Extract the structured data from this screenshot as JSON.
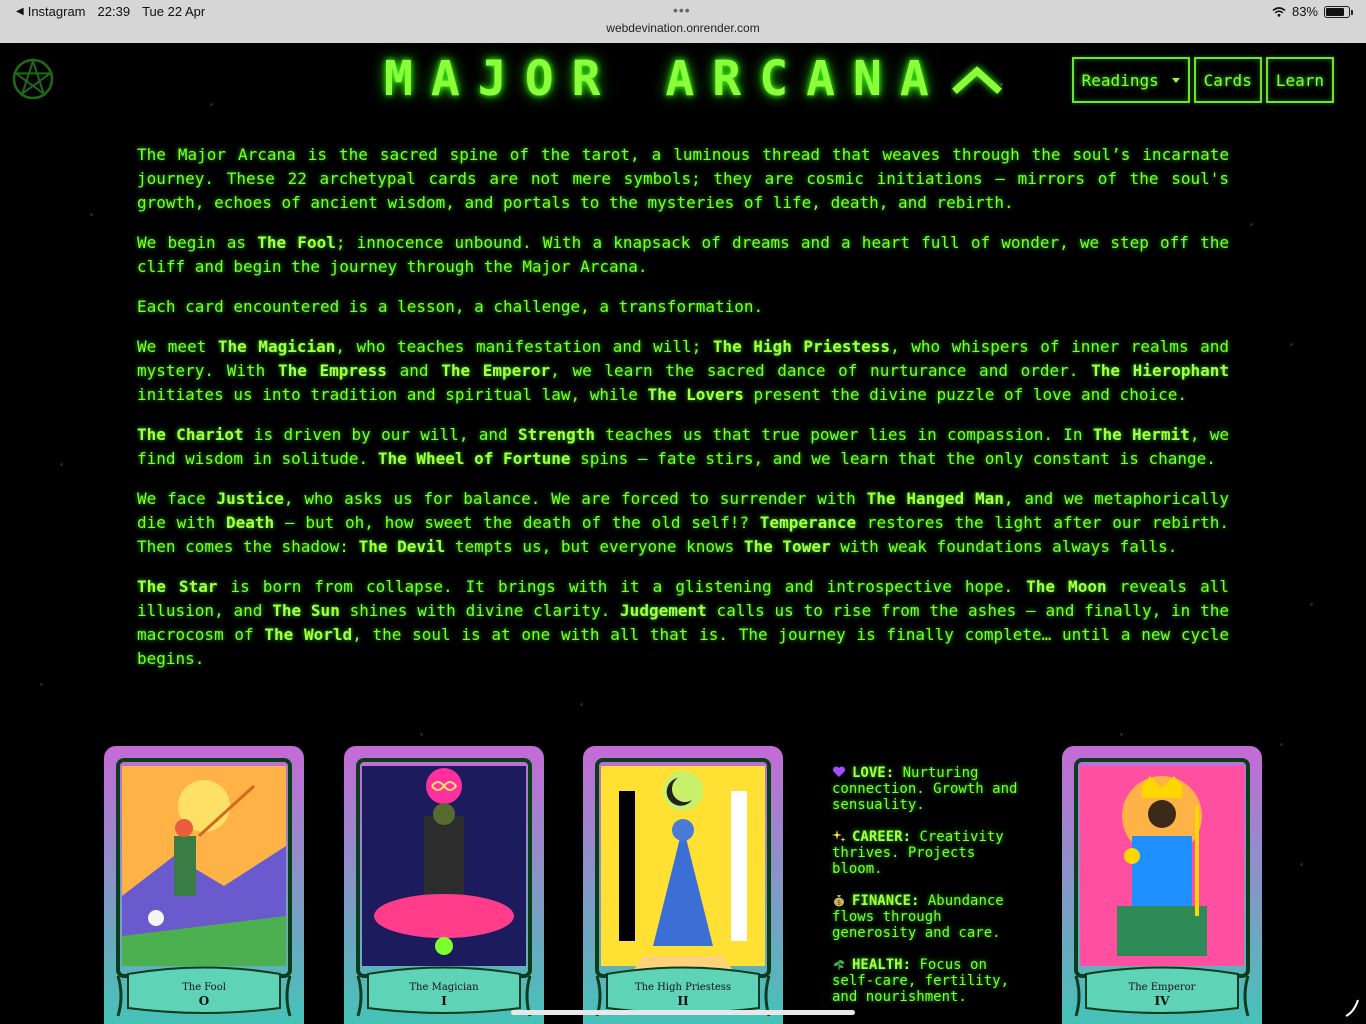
{
  "statusbar": {
    "back_app": "Instagram",
    "time": "22:39",
    "date": "Tue 22 Apr",
    "url": "webdevination.onrender.com",
    "battery": "83%",
    "battery_level": 0.83
  },
  "header": {
    "logo_icon": "pentagram-icon",
    "title": "MAJOR ARCANA",
    "collapse_icon": "chevron-up-icon"
  },
  "nav": {
    "readings_label": "Readings",
    "cards_label": "Cards",
    "learn_label": "Learn"
  },
  "article": {
    "paragraphs": [
      [
        {
          "t": "The Major Arcana is the sacred spine of the tarot, a luminous thread that weaves through the soul’s incarnate journey. These 22 archetypal cards are not mere symbols; they are cosmic initiations — mirrors of the soul's growth, echoes of ancient wisdom, and portals to the mysteries of life, death, and rebirth."
        }
      ],
      [
        {
          "t": "We begin as "
        },
        {
          "b": "The Fool"
        },
        {
          "t": "; innocence unbound. With a knapsack of dreams and a heart full of wonder, we step off the cliff and begin the journey through the Major Arcana."
        }
      ],
      [
        {
          "t": "Each card encountered is a lesson, a challenge, a transformation."
        }
      ],
      [
        {
          "t": "We meet "
        },
        {
          "b": "The Magician"
        },
        {
          "t": ", who teaches manifestation and will; "
        },
        {
          "b": "The High Priestess"
        },
        {
          "t": ", who whispers of inner realms and mystery. With "
        },
        {
          "b": "The Empress"
        },
        {
          "t": " and "
        },
        {
          "b": "The Emperor"
        },
        {
          "t": ", we learn the sacred dance of nurturance and order. "
        },
        {
          "b": "The Hierophant"
        },
        {
          "t": " initiates us into tradition and spiritual law, while "
        },
        {
          "b": "The Lovers"
        },
        {
          "t": " present the divine puzzle of love and choice."
        }
      ],
      [
        {
          "b": "The Chariot"
        },
        {
          "t": " is driven by our will, and "
        },
        {
          "b": "Strength"
        },
        {
          "t": " teaches us that true power lies in compassion. In "
        },
        {
          "b": "The Hermit"
        },
        {
          "t": ", we find wisdom in solitude. "
        },
        {
          "b": "The Wheel of Fortune"
        },
        {
          "t": " spins — fate stirs, and we learn that the only constant is change."
        }
      ],
      [
        {
          "t": "We face "
        },
        {
          "b": "Justice"
        },
        {
          "t": ", who asks us for balance. We are forced to surrender with "
        },
        {
          "b": "The Hanged Man"
        },
        {
          "t": ", and we metaphorically die with "
        },
        {
          "b": "Death"
        },
        {
          "t": " — but oh, how sweet the death of the old self!? "
        },
        {
          "b": "Temperance"
        },
        {
          "t": " restores the light after our rebirth. Then comes the shadow: "
        },
        {
          "b": "The Devil"
        },
        {
          "t": " tempts us, but everyone knows "
        },
        {
          "b": "The Tower"
        },
        {
          "t": " with weak foundations always falls."
        }
      ],
      [
        {
          "b": "The Star"
        },
        {
          "t": " is born from collapse. It brings with it a glistening and introspective hope. "
        },
        {
          "b": "The Moon"
        },
        {
          "t": " reveals all illusion, and "
        },
        {
          "b": "The Sun"
        },
        {
          "t": " shines with divine clarity. "
        },
        {
          "b": "Judgement"
        },
        {
          "t": " calls us to rise from the ashes — and finally, in the macrocosm of "
        },
        {
          "b": "The World"
        },
        {
          "t": ", the soul is at one with all that is. The journey is finally complete… until a new cycle begins."
        }
      ]
    ]
  },
  "cards": [
    {
      "name": "The Fool",
      "numeral": "O"
    },
    {
      "name": "The Magician",
      "numeral": "I"
    },
    {
      "name": "The High Priestess",
      "numeral": "II"
    },
    {
      "name": "The Emperor",
      "numeral": "IV"
    }
  ],
  "meanings": [
    {
      "icon": "purple-heart-icon",
      "label": "LOVE:",
      "text": "Nurturing connection. Growth and sensuality."
    },
    {
      "icon": "sparkles-icon",
      "label": "CAREER:",
      "text": "Creativity thrives. Projects bloom."
    },
    {
      "icon": "money-bag-icon",
      "label": "FINANCE:",
      "text": "Abundance flows through generosity and care."
    },
    {
      "icon": "herb-icon",
      "label": "HEALTH:",
      "text": "Focus on self-care, fertility, and nourishment."
    }
  ],
  "colors": {
    "neon_green": "#7dff2e",
    "background": "#000000",
    "card_top": "#c56ad6",
    "card_bottom": "#3fc7b6"
  }
}
